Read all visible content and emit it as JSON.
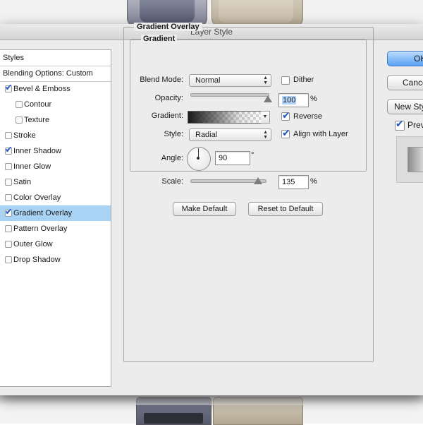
{
  "window": {
    "title": "Layer Style"
  },
  "styles_panel": {
    "header": "Styles",
    "blending": "Blending Options: Custom",
    "items": [
      {
        "label": "Bevel & Emboss",
        "checked": true,
        "indent": false,
        "selected": false
      },
      {
        "label": "Contour",
        "checked": false,
        "indent": true,
        "selected": false
      },
      {
        "label": "Texture",
        "checked": false,
        "indent": true,
        "selected": false
      },
      {
        "label": "Stroke",
        "checked": false,
        "indent": false,
        "selected": false
      },
      {
        "label": "Inner Shadow",
        "checked": true,
        "indent": false,
        "selected": false
      },
      {
        "label": "Inner Glow",
        "checked": false,
        "indent": false,
        "selected": false
      },
      {
        "label": "Satin",
        "checked": false,
        "indent": false,
        "selected": false
      },
      {
        "label": "Color Overlay",
        "checked": false,
        "indent": false,
        "selected": false
      },
      {
        "label": "Gradient Overlay",
        "checked": true,
        "indent": false,
        "selected": true
      },
      {
        "label": "Pattern Overlay",
        "checked": false,
        "indent": false,
        "selected": false
      },
      {
        "label": "Outer Glow",
        "checked": false,
        "indent": false,
        "selected": false
      },
      {
        "label": "Drop Shadow",
        "checked": false,
        "indent": false,
        "selected": false
      }
    ]
  },
  "gradient_overlay": {
    "section_title": "Gradient Overlay",
    "subsection_title": "Gradient",
    "blend_mode_label": "Blend Mode:",
    "blend_mode_value": "Normal",
    "dither_label": "Dither",
    "dither_checked": false,
    "opacity_label": "Opacity:",
    "opacity_value": "100",
    "opacity_unit": "%",
    "opacity_level": 1.0,
    "gradient_label": "Gradient:",
    "reverse_label": "Reverse",
    "reverse_checked": true,
    "style_label": "Style:",
    "style_value": "Radial",
    "align_label": "Align with Layer",
    "align_checked": true,
    "angle_label": "Angle:",
    "angle_value": "90",
    "angle_unit": "°",
    "scale_label": "Scale:",
    "scale_value": "135",
    "scale_unit": "%",
    "make_default": "Make Default",
    "reset_default": "Reset to Default"
  },
  "right_buttons": {
    "ok": "OK",
    "cancel": "Cancel",
    "new_style": "New Style...",
    "preview": "Preview",
    "preview_checked": true
  },
  "colors": {
    "selection": "#a8d3f5",
    "checkmark": "#1f56c4",
    "ok_button": "#5aa2f2"
  }
}
